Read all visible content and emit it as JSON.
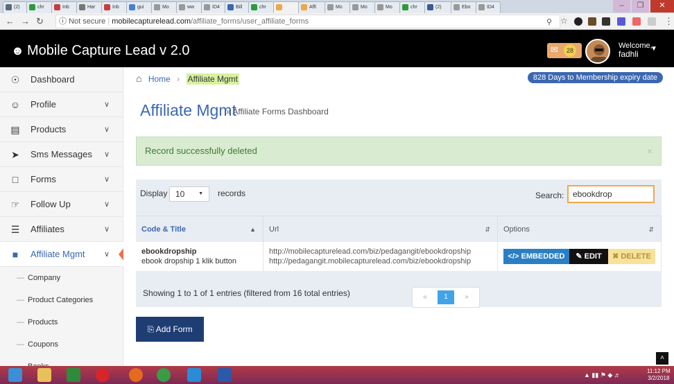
{
  "browser": {
    "tabs": [
      {
        "label": "(2)",
        "color": "#5a6b7c"
      },
      {
        "label": "chr",
        "color": "#2b9b3b"
      },
      {
        "label": "Inb",
        "color": "#c83d3d"
      },
      {
        "label": "Har",
        "color": "#777777"
      },
      {
        "label": "Inb",
        "color": "#c83d3d"
      },
      {
        "label": "gui",
        "color": "#4a7fd6"
      },
      {
        "label": "Mo",
        "color": "#999999"
      },
      {
        "label": "ww",
        "color": "#999999"
      },
      {
        "label": "ID4",
        "color": "#999999"
      },
      {
        "label": "Bill",
        "color": "#3a67b1"
      },
      {
        "label": "chr",
        "color": "#2b9b3b"
      },
      {
        "label": "",
        "color": "#f0a848"
      },
      {
        "label": "Affi",
        "color": "#f0a848"
      },
      {
        "label": "Mo",
        "color": "#999999"
      },
      {
        "label": "Mo",
        "color": "#999999"
      },
      {
        "label": "Mo",
        "color": "#999999"
      },
      {
        "label": "chr",
        "color": "#2b9b3b"
      },
      {
        "label": "(2)",
        "color": "#3b5998"
      },
      {
        "label": "Ebo",
        "color": "#999999"
      },
      {
        "label": "ID4",
        "color": "#999999"
      }
    ],
    "url_security": "Not secure",
    "url_host": "mobilecapturelead.com",
    "url_path": "/affiliate_forms/user_affiliate_forms"
  },
  "header": {
    "brand": "Mobile Capture Lead v 2.0",
    "mail_count": "28",
    "welcome_line1": "Welcome,",
    "welcome_line2": "fadhli"
  },
  "sidebar": {
    "items": [
      {
        "label": "Dashboard",
        "icon": "dashboard-icon",
        "glyph": "☉",
        "chevron": ""
      },
      {
        "label": "Profile",
        "icon": "user-icon",
        "glyph": "☺",
        "chevron": "∨"
      },
      {
        "label": "Products",
        "icon": "briefcase-icon",
        "glyph": "▤",
        "chevron": "∨"
      },
      {
        "label": "Sms Messages",
        "icon": "send-icon",
        "glyph": "➤",
        "chevron": "∨"
      },
      {
        "label": "Forms",
        "icon": "file-icon",
        "glyph": "□",
        "chevron": "∨"
      },
      {
        "label": "Follow Up",
        "icon": "hand-icon",
        "glyph": "☞",
        "chevron": "∨"
      },
      {
        "label": "Affiliates",
        "icon": "list-icon",
        "glyph": "☰",
        "chevron": "∨"
      },
      {
        "label": "Affiliate Mgmt",
        "icon": "book-icon",
        "glyph": "■",
        "chevron": "∨"
      }
    ],
    "subitems": [
      "Company",
      "Product Categories",
      "Products",
      "Coupons",
      "Banks"
    ]
  },
  "breadcrumb": {
    "home": "Home",
    "current": "Affiliate Mgmt"
  },
  "expiry": "828 Days to Membership expiry date",
  "page": {
    "title": "Affiliate Mgmt",
    "subtitle": "» Affiliate Forms Dashboard"
  },
  "alert": {
    "message": "Record successfully deleted",
    "close": "×"
  },
  "table": {
    "display_label": "Display",
    "page_size": "10",
    "records_label": "records",
    "search_label": "Search:",
    "search_value": "ebookdrop",
    "columns": [
      "Code & Title",
      "Url",
      "Options"
    ],
    "rows": [
      {
        "title": "ebookdropship",
        "subtitle": "ebook dropship 1 klik button",
        "url1": "http://mobilecapturelead.com/biz/pedagangit/ebookdropship",
        "url2": "http://pedagangit.mobilecapturelead.com/biz/ebookdropship",
        "embed_label": "</> EMBEDDED",
        "edit_label": "✎ EDIT",
        "delete_label": "✖ DELETE"
      }
    ],
    "showing": "Showing 1 to 1 of 1 entries (filtered from 16 total entries)",
    "pager": {
      "prev": "«",
      "current": "1",
      "next": "»"
    }
  },
  "add_button": "⎘ Add Form",
  "taskbar": {
    "time": "11:12 PM",
    "date": "3/2/2018"
  }
}
